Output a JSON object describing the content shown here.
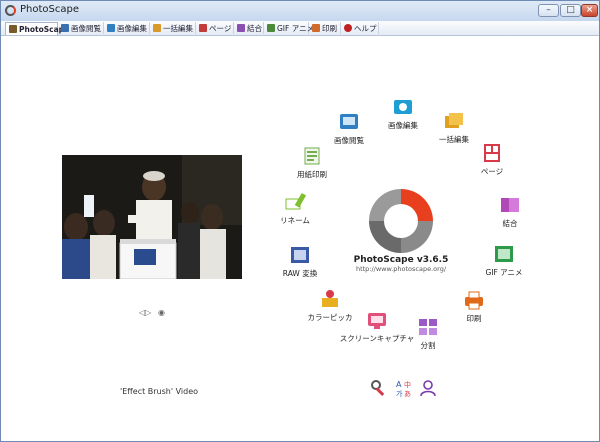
{
  "window": {
    "title": "PhotoScape"
  },
  "tabs": [
    {
      "label": "PhotoScape",
      "icon": "photoscape-tab-icon",
      "color": "#7a5a2a"
    },
    {
      "label": "画像閲覧",
      "icon": "viewer-tab-icon",
      "color": "#3a6fb0"
    },
    {
      "label": "画像編集",
      "icon": "editor-tab-icon",
      "color": "#2f7fc2"
    },
    {
      "label": "一括編集",
      "icon": "batch-tab-icon",
      "color": "#d89a2a"
    },
    {
      "label": "ページ",
      "icon": "page-tab-icon",
      "color": "#c23a3a"
    },
    {
      "label": "結合",
      "icon": "combine-tab-icon",
      "color": "#8a4fb0"
    },
    {
      "label": "GIF アニメ",
      "icon": "gif-tab-icon",
      "color": "#4a8a3a"
    },
    {
      "label": "印刷",
      "icon": "print-tab-icon",
      "color": "#d06a2a"
    },
    {
      "label": "ヘルプ",
      "icon": "help-tab-icon",
      "color": "#c02020"
    }
  ],
  "photo": {
    "controls": [
      "◁▷",
      "◉"
    ],
    "caption": "'Effect Brush' Video"
  },
  "logo": {
    "version": "PhotoScape v3.6.5",
    "url": "http://www.photoscape.org/"
  },
  "menu": [
    {
      "label": "画像閲覧",
      "icon": "viewer-icon",
      "color": "#2f7fc2"
    },
    {
      "label": "画像編集",
      "icon": "editor-icon",
      "color": "#1f9ed6"
    },
    {
      "label": "一括編集",
      "icon": "batch-editor-icon",
      "color": "#e0a020"
    },
    {
      "label": "ページ",
      "icon": "page-icon",
      "color": "#d83a4a"
    },
    {
      "label": "結合",
      "icon": "combine-icon",
      "color": "#b048b8"
    },
    {
      "label": "GIF アニメ",
      "icon": "gif-animation-icon",
      "color": "#2f9a4a"
    },
    {
      "label": "印刷",
      "icon": "print-icon",
      "color": "#e06a1a"
    },
    {
      "label": "分割",
      "icon": "splitter-icon",
      "color": "#9b59c6"
    },
    {
      "label": "スクリーンキャプチャ",
      "icon": "screen-capture-icon",
      "color": "#e0507a"
    },
    {
      "label": "カラーピッカ",
      "icon": "color-picker-icon",
      "color": "#e8b020"
    },
    {
      "label": "RAW 変換",
      "icon": "raw-converter-icon",
      "color": "#3a5aa8"
    },
    {
      "label": "リネーム",
      "icon": "rename-icon",
      "color": "#7fbf2f"
    },
    {
      "label": "用紙印刷",
      "icon": "paper-print-icon",
      "color": "#6fb04a"
    }
  ],
  "bottom_icons": [
    "tools-icon",
    "language-icon",
    "user-icon"
  ]
}
